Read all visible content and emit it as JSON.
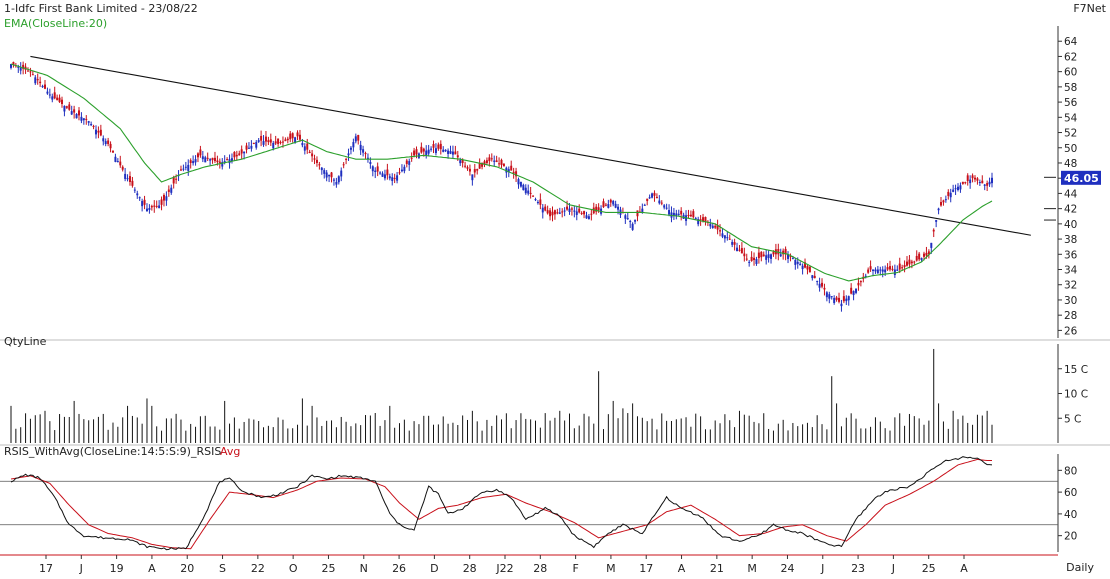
{
  "header": {
    "title": "1-Idfc First Bank Limited - 23/08/22",
    "brand": "F7Net"
  },
  "chart_data": [
    {
      "type": "candlestick",
      "panel": "price",
      "ylim": [
        25,
        66
      ],
      "yticks": [
        26,
        28,
        30,
        32,
        34,
        36,
        38,
        40,
        42,
        44,
        46,
        48,
        50,
        52,
        54,
        56,
        58,
        60,
        62,
        64
      ],
      "last_price_label": "46.05",
      "last_price": 46.05,
      "overlay_label": "EMA(CloseLine:20)",
      "colors": {
        "up": "#1f2fbf",
        "down": "#c8101a",
        "ema": "#2ca02c",
        "trendline": "#111111",
        "last_price_bg": "#1f2fbf"
      },
      "close_anchors": [
        [
          0,
          61
        ],
        [
          8,
          60
        ],
        [
          16,
          57
        ],
        [
          24,
          55
        ],
        [
          32,
          53.5
        ],
        [
          40,
          50.5
        ],
        [
          48,
          46
        ],
        [
          56,
          42
        ],
        [
          62,
          42.5
        ],
        [
          70,
          47
        ],
        [
          78,
          49
        ],
        [
          86,
          48
        ],
        [
          94,
          49
        ],
        [
          102,
          51
        ],
        [
          110,
          50.5
        ],
        [
          118,
          51.5
        ],
        [
          126,
          48
        ],
        [
          134,
          45.5
        ],
        [
          142,
          51.5
        ],
        [
          150,
          47
        ],
        [
          158,
          46
        ],
        [
          166,
          49
        ],
        [
          174,
          50
        ],
        [
          182,
          49.5
        ],
        [
          190,
          46.5
        ],
        [
          198,
          48.5
        ],
        [
          206,
          47
        ],
        [
          214,
          44
        ],
        [
          222,
          41
        ],
        [
          230,
          42
        ],
        [
          238,
          41
        ],
        [
          248,
          43
        ],
        [
          256,
          40
        ],
        [
          264,
          44
        ],
        [
          272,
          41.5
        ],
        [
          280,
          41
        ],
        [
          288,
          40
        ],
        [
          296,
          38
        ],
        [
          304,
          35
        ],
        [
          312,
          36
        ],
        [
          320,
          36
        ],
        [
          328,
          34
        ],
        [
          336,
          31
        ],
        [
          342,
          29.5
        ],
        [
          348,
          31.5
        ],
        [
          354,
          34
        ],
        [
          360,
          34
        ],
        [
          366,
          34
        ],
        [
          372,
          35
        ],
        [
          378,
          36
        ],
        [
          382,
          42
        ],
        [
          388,
          44.5
        ],
        [
          396,
          46
        ],
        [
          402,
          45
        ],
        [
          404,
          46.05
        ]
      ],
      "ema_anchors": [
        [
          0,
          61
        ],
        [
          15,
          59.5
        ],
        [
          30,
          56.5
        ],
        [
          45,
          52.5
        ],
        [
          55,
          48
        ],
        [
          62,
          45.5
        ],
        [
          70,
          46.5
        ],
        [
          80,
          47.5
        ],
        [
          95,
          48.5
        ],
        [
          110,
          50
        ],
        [
          120,
          51
        ],
        [
          130,
          49.5
        ],
        [
          142,
          48.5
        ],
        [
          155,
          48.5
        ],
        [
          170,
          49
        ],
        [
          185,
          48.5
        ],
        [
          200,
          47.5
        ],
        [
          215,
          45.5
        ],
        [
          230,
          42.5
        ],
        [
          245,
          41.5
        ],
        [
          260,
          41.5
        ],
        [
          275,
          41
        ],
        [
          290,
          40
        ],
        [
          305,
          37
        ],
        [
          320,
          36
        ],
        [
          335,
          33.5
        ],
        [
          345,
          32.5
        ],
        [
          355,
          33.2
        ],
        [
          365,
          33.6
        ],
        [
          375,
          35
        ],
        [
          383,
          37.5
        ],
        [
          392,
          40.5
        ],
        [
          400,
          42.3
        ],
        [
          404,
          43
        ]
      ],
      "trendline": [
        [
          8,
          62
        ],
        [
          420,
          38.5
        ]
      ],
      "breakout_markers": [
        42,
        40.5
      ]
    },
    {
      "type": "bar",
      "panel": "volume",
      "title": "QtyLine",
      "ylim": [
        0,
        20
      ],
      "yticks": [
        5,
        10,
        15
      ],
      "ytick_labels": [
        "5 C",
        "10 C",
        "15 C"
      ],
      "color": "#111111",
      "base_level": 4.5,
      "spikes": [
        [
          0,
          7.5
        ],
        [
          6,
          6
        ],
        [
          14,
          6.5
        ],
        [
          26,
          8.5
        ],
        [
          48,
          7.5
        ],
        [
          56,
          9
        ],
        [
          58,
          7.5
        ],
        [
          88,
          8.5
        ],
        [
          120,
          9
        ],
        [
          124,
          7.5
        ],
        [
          156,
          7.5
        ],
        [
          190,
          6.5
        ],
        [
          226,
          6.5
        ],
        [
          242,
          14.5
        ],
        [
          248,
          8.5
        ],
        [
          252,
          7
        ],
        [
          256,
          8
        ],
        [
          300,
          6.5
        ],
        [
          338,
          13.5
        ],
        [
          340,
          8
        ],
        [
          346,
          6
        ],
        [
          366,
          6
        ],
        [
          380,
          19
        ],
        [
          383,
          8
        ],
        [
          388,
          6.5
        ],
        [
          402,
          6.5
        ]
      ]
    },
    {
      "type": "line",
      "panel": "rsi",
      "title": "RSIS_WithAvg(CloseLine:14:5:S:9)_RSIS",
      "avg_label": "Avg",
      "ylim": [
        5,
        95
      ],
      "yticks": [
        20,
        40,
        60,
        80
      ],
      "hlines": [
        70,
        30
      ],
      "colors": {
        "rsi": "#111111",
        "avg": "#c8101a"
      },
      "series": [
        {
          "anchors": [
            [
              0,
              70
            ],
            [
              6,
              76
            ],
            [
              12,
              73
            ],
            [
              18,
              55
            ],
            [
              24,
              30
            ],
            [
              30,
              20
            ],
            [
              38,
              18
            ],
            [
              48,
              17
            ],
            [
              56,
              10
            ],
            [
              64,
              8
            ],
            [
              72,
              8
            ],
            [
              80,
              40
            ],
            [
              86,
              70
            ],
            [
              90,
              72
            ],
            [
              96,
              60
            ],
            [
              104,
              55
            ],
            [
              110,
              58
            ],
            [
              118,
              65
            ],
            [
              124,
              75
            ],
            [
              130,
              72
            ],
            [
              136,
              75
            ],
            [
              144,
              73
            ],
            [
              150,
              70
            ],
            [
              156,
              40
            ],
            [
              160,
              30
            ],
            [
              166,
              25
            ],
            [
              172,
              65
            ],
            [
              176,
              58
            ],
            [
              180,
              40
            ],
            [
              186,
              45
            ],
            [
              194,
              60
            ],
            [
              200,
              62
            ],
            [
              206,
              55
            ],
            [
              212,
              35
            ],
            [
              220,
              45
            ],
            [
              226,
              38
            ],
            [
              232,
              20
            ],
            [
              240,
              10
            ],
            [
              246,
              22
            ],
            [
              252,
              30
            ],
            [
              260,
              22
            ],
            [
              270,
              55
            ],
            [
              276,
              45
            ],
            [
              284,
              38
            ],
            [
              292,
              20
            ],
            [
              300,
              15
            ],
            [
              308,
              20
            ],
            [
              314,
              30
            ],
            [
              320,
              25
            ],
            [
              326,
              22
            ],
            [
              336,
              12
            ],
            [
              342,
              10
            ],
            [
              348,
              35
            ],
            [
              356,
              55
            ],
            [
              362,
              62
            ],
            [
              370,
              65
            ],
            [
              376,
              75
            ],
            [
              384,
              88
            ],
            [
              392,
              92
            ],
            [
              398,
              91
            ],
            [
              402,
              86
            ]
          ]
        },
        {
          "name": "Avg",
          "anchors": [
            [
              0,
              72
            ],
            [
              8,
              75
            ],
            [
              16,
              68
            ],
            [
              24,
              48
            ],
            [
              32,
              30
            ],
            [
              40,
              22
            ],
            [
              50,
              18
            ],
            [
              58,
              12
            ],
            [
              66,
              9
            ],
            [
              74,
              8
            ],
            [
              82,
              35
            ],
            [
              90,
              60
            ],
            [
              98,
              58
            ],
            [
              108,
              55
            ],
            [
              118,
              62
            ],
            [
              126,
              70
            ],
            [
              136,
              73
            ],
            [
              146,
              72
            ],
            [
              154,
              65
            ],
            [
              160,
              50
            ],
            [
              168,
              35
            ],
            [
              176,
              45
            ],
            [
              184,
              48
            ],
            [
              194,
              55
            ],
            [
              204,
              58
            ],
            [
              212,
              50
            ],
            [
              222,
              42
            ],
            [
              232,
              32
            ],
            [
              242,
              18
            ],
            [
              252,
              24
            ],
            [
              262,
              30
            ],
            [
              270,
              42
            ],
            [
              280,
              48
            ],
            [
              290,
              35
            ],
            [
              300,
              20
            ],
            [
              310,
              22
            ],
            [
              318,
              28
            ],
            [
              326,
              30
            ],
            [
              336,
              20
            ],
            [
              344,
              15
            ],
            [
              352,
              30
            ],
            [
              360,
              48
            ],
            [
              370,
              58
            ],
            [
              380,
              70
            ],
            [
              390,
              85
            ],
            [
              398,
              90
            ],
            [
              402,
              89
            ]
          ]
        }
      ]
    }
  ],
  "x_axis": {
    "labels": [
      "17",
      "J",
      "19",
      "A",
      "20",
      "S",
      "22",
      "O",
      "25",
      "N",
      "26",
      "D",
      "28",
      "J22",
      "28",
      "F",
      "M",
      "17",
      "A",
      "21",
      "M",
      "24",
      "J",
      "23",
      "J",
      "25",
      "A"
    ],
    "period": "Daily"
  }
}
